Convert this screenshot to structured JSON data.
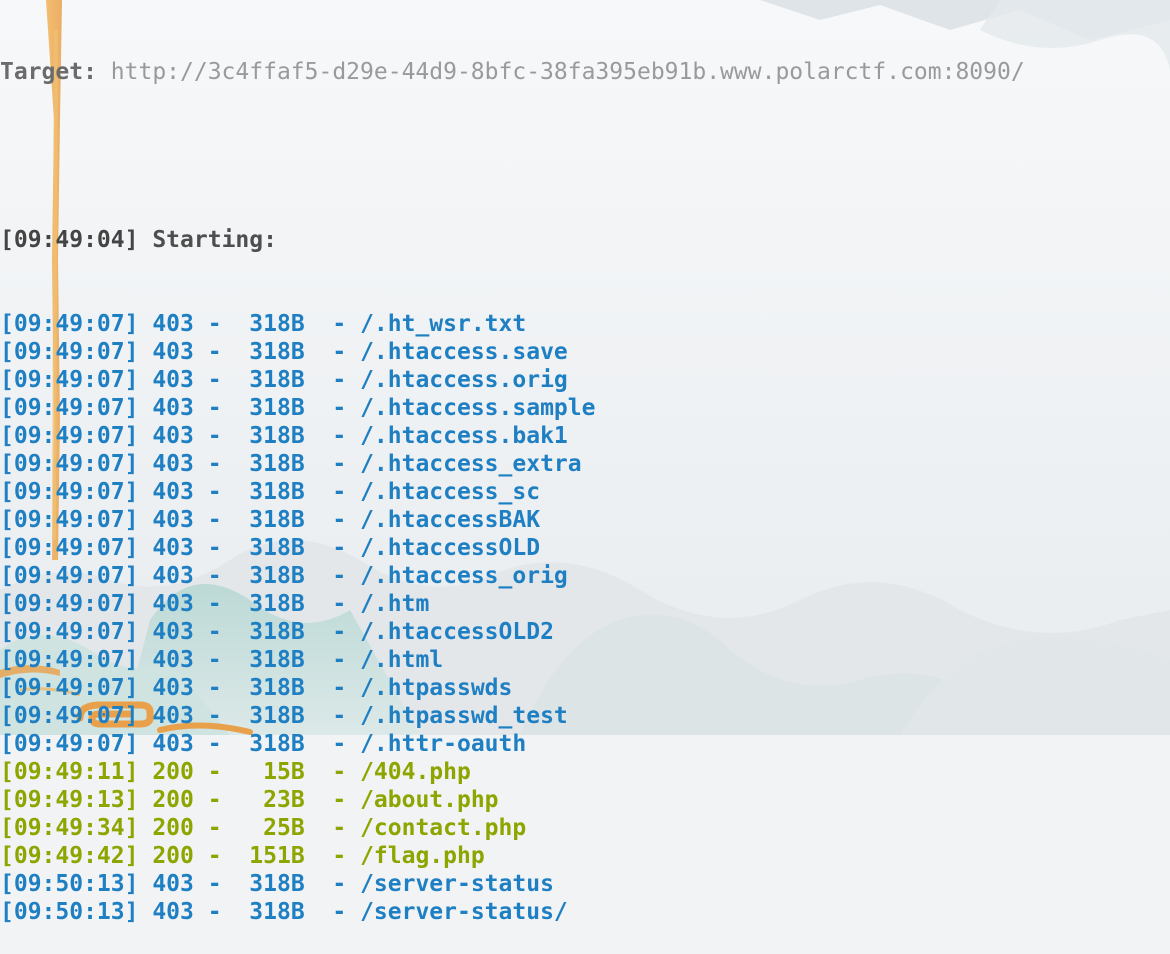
{
  "terminal": {
    "target_label": "Target: ",
    "target_url": "http://3c4ffaf5-d29e-44d9-8bfc-38fa395eb91b.www.polarctf.com:8090/",
    "start_line": {
      "time": "[09:49:04]",
      "message": " Starting:"
    },
    "results": [
      {
        "time": "[09:49:07]",
        "status": "403",
        "size": "318B",
        "path": "/.ht_wsr.txt"
      },
      {
        "time": "[09:49:07]",
        "status": "403",
        "size": "318B",
        "path": "/.htaccess.save"
      },
      {
        "time": "[09:49:07]",
        "status": "403",
        "size": "318B",
        "path": "/.htaccess.orig"
      },
      {
        "time": "[09:49:07]",
        "status": "403",
        "size": "318B",
        "path": "/.htaccess.sample"
      },
      {
        "time": "[09:49:07]",
        "status": "403",
        "size": "318B",
        "path": "/.htaccess.bak1"
      },
      {
        "time": "[09:49:07]",
        "status": "403",
        "size": "318B",
        "path": "/.htaccess_extra"
      },
      {
        "time": "[09:49:07]",
        "status": "403",
        "size": "318B",
        "path": "/.htaccess_sc"
      },
      {
        "time": "[09:49:07]",
        "status": "403",
        "size": "318B",
        "path": "/.htaccessBAK"
      },
      {
        "time": "[09:49:07]",
        "status": "403",
        "size": "318B",
        "path": "/.htaccessOLD"
      },
      {
        "time": "[09:49:07]",
        "status": "403",
        "size": "318B",
        "path": "/.htaccess_orig"
      },
      {
        "time": "[09:49:07]",
        "status": "403",
        "size": "318B",
        "path": "/.htm"
      },
      {
        "time": "[09:49:07]",
        "status": "403",
        "size": "318B",
        "path": "/.htaccessOLD2"
      },
      {
        "time": "[09:49:07]",
        "status": "403",
        "size": "318B",
        "path": "/.html"
      },
      {
        "time": "[09:49:07]",
        "status": "403",
        "size": "318B",
        "path": "/.htpasswds"
      },
      {
        "time": "[09:49:07]",
        "status": "403",
        "size": "318B",
        "path": "/.htpasswd_test"
      },
      {
        "time": "[09:49:07]",
        "status": "403",
        "size": "318B",
        "path": "/.httr-oauth"
      },
      {
        "time": "[09:49:11]",
        "status": "200",
        "size": "15B",
        "path": "/404.php"
      },
      {
        "time": "[09:49:13]",
        "status": "200",
        "size": "23B",
        "path": "/about.php"
      },
      {
        "time": "[09:49:34]",
        "status": "200",
        "size": "25B",
        "path": "/contact.php"
      },
      {
        "time": "[09:49:42]",
        "status": "200",
        "size": "151B",
        "path": "/flag.php"
      },
      {
        "time": "[09:50:13]",
        "status": "403",
        "size": "318B",
        "path": "/server-status"
      },
      {
        "time": "[09:50:13]",
        "status": "403",
        "size": "318B",
        "path": "/server-status/"
      }
    ]
  },
  "colors": {
    "status_403": "#1f7fc3",
    "status_200": "#8ea500",
    "info_text": "#4e4e4e",
    "target_url": "#9a9a9a"
  }
}
